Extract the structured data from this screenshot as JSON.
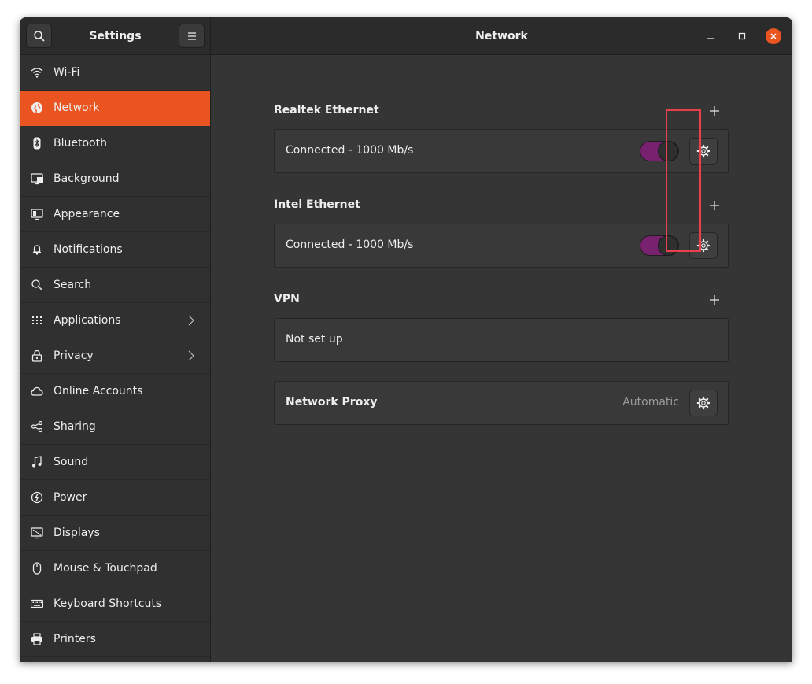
{
  "window": {
    "sidebar_title": "Settings",
    "main_title": "Network"
  },
  "sidebar": {
    "items": [
      {
        "label": "Wi-Fi",
        "icon": "wifi-icon"
      },
      {
        "label": "Network",
        "icon": "network-icon",
        "active": true
      },
      {
        "label": "Bluetooth",
        "icon": "bluetooth-icon"
      },
      {
        "label": "Background",
        "icon": "background-icon"
      },
      {
        "label": "Appearance",
        "icon": "appearance-icon"
      },
      {
        "label": "Notifications",
        "icon": "bell-icon"
      },
      {
        "label": "Search",
        "icon": "search-icon"
      },
      {
        "label": "Applications",
        "icon": "apps-grid-icon",
        "chevron": true
      },
      {
        "label": "Privacy",
        "icon": "lock-icon",
        "chevron": true
      },
      {
        "label": "Online Accounts",
        "icon": "cloud-icon"
      },
      {
        "label": "Sharing",
        "icon": "share-icon"
      },
      {
        "label": "Sound",
        "icon": "music-note-icon"
      },
      {
        "label": "Power",
        "icon": "power-icon"
      },
      {
        "label": "Displays",
        "icon": "display-icon"
      },
      {
        "label": "Mouse & Touchpad",
        "icon": "mouse-icon"
      },
      {
        "label": "Keyboard Shortcuts",
        "icon": "keyboard-icon"
      },
      {
        "label": "Printers",
        "icon": "printer-icon"
      }
    ]
  },
  "main": {
    "realtek": {
      "title": "Realtek Ethernet",
      "status": "Connected - 1000 Mb/s",
      "enabled": true
    },
    "intel": {
      "title": "Intel Ethernet",
      "status": "Connected - 1000 Mb/s",
      "enabled": true
    },
    "vpn": {
      "title": "VPN",
      "status": "Not set up"
    },
    "proxy": {
      "label": "Network Proxy",
      "value": "Automatic"
    }
  },
  "colors": {
    "accent": "#e95420",
    "toggle_on": "#77216f",
    "highlight": "#e8414d",
    "window_bg": "#353535"
  }
}
